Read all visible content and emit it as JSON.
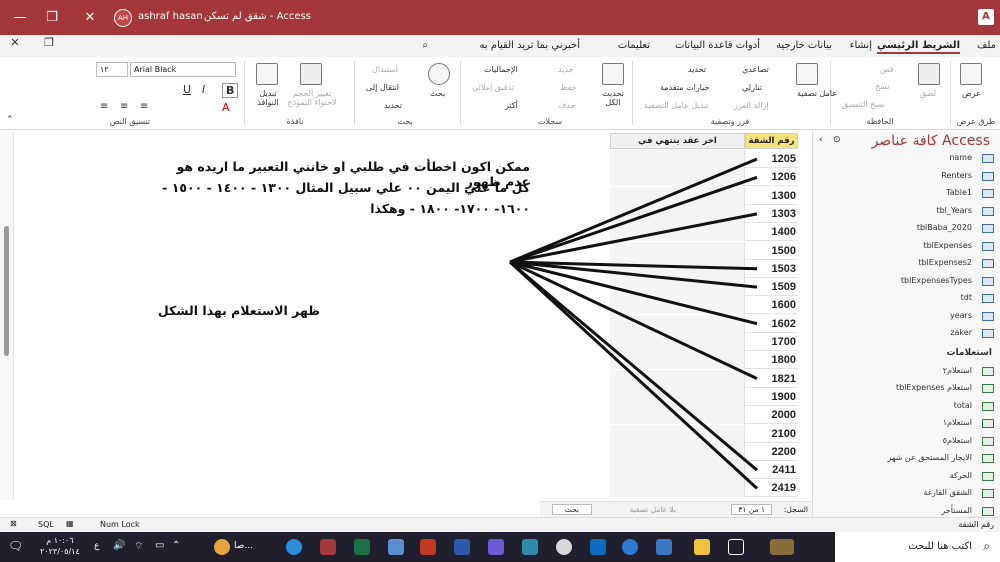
{
  "titlebar": {
    "title": "شقق لم تسكن  -  Access",
    "user_name": "ashraf hasan",
    "user_initials": "AH",
    "minimize": "—",
    "restore": "❐",
    "close": "✕"
  },
  "menu": {
    "items": [
      "ملف",
      "الشريط الرئيسي",
      "إنشاء",
      "بيانات خارجية",
      "أدوات قاعدة البيانات",
      "تعليمات"
    ],
    "tell_me": "أخبرني بما تريد القيام به"
  },
  "ribbon": {
    "groups": {
      "views": "طرق عرض",
      "clipboard": "الحافظة",
      "sort_filter": "فرز وتصفية",
      "records": "سجلات",
      "find": "بحث",
      "window": "نافذة",
      "text_format": "تنسيق النص"
    },
    "view_btn": "عرض",
    "paste": "لصق",
    "cut": "قص",
    "copy": "نسخ",
    "format_painter": "نسخ التنسيق",
    "filter": "عامل تصفية",
    "ascending": "تصاعدي",
    "descending": "تنازلي",
    "remove_sort": "إزالة الفرز",
    "selection": "تحديد",
    "advanced": "خيارات متقدمة",
    "toggle_filter": "تبديل عامل التصفية",
    "refresh_all": "تحديث الكل",
    "new": "جديد",
    "save": "حفظ",
    "delete": "حذف",
    "totals": "الإجماليات",
    "spelling": "تدقيق إملائي",
    "more": "أكثر",
    "find_btn": "بحث",
    "replace": "استبدال",
    "goto": "انتقال إلى",
    "select": "تحديد",
    "size_to_fit": "تغيير الحجم لاحتواء النموذج",
    "switch_windows": "تبديل النوافذ",
    "font_name": "Arial Black",
    "font_size": "١٢"
  },
  "nav": {
    "title": "كافة عناصر Access",
    "tables": [
      "name",
      "Renters",
      "Table1",
      "tbl_Years",
      "tblBaba_2020",
      "tblExpenses",
      "tblExpenses2",
      "tblExpensesTypes",
      "tdt",
      "years",
      "zaker"
    ],
    "queries_header": "استعلامات",
    "queries": [
      "استعلام٢",
      "tblExpenses استعلام",
      "total",
      "استعلام١",
      "استعلام٥",
      "الايجار المستحق عن شهر",
      "الحركة",
      "الشقق الفارغة",
      "المستأجر"
    ]
  },
  "sheet": {
    "col_apartment": "رقم الشقة",
    "col_contract": "اخر عقد ينتهي في",
    "rows": [
      "1205",
      "1206",
      "1300",
      "1303",
      "1400",
      "1500",
      "1503",
      "1509",
      "1600",
      "1602",
      "1700",
      "1800",
      "1821",
      "1900",
      "2000",
      "2100",
      "2200",
      "2411",
      "2419"
    ],
    "record_label": "السجل:",
    "record_pos": "١ من ٣١",
    "no_filter": "بلا عامل تصفية",
    "search": "بحث"
  },
  "notes": {
    "line1": "ممكن اكون اخطأت في طلبي او خانني التعبير  ما اريده هو عدم ظهور",
    "line2": "كل ما علي اليمن ٠٠ علي سبيل المثال ١٣٠٠ - ١٤٠٠ - ١٥٠٠ -",
    "line3": "١٦٠٠- ١٧٠٠- ١٨٠٠ - وهكذا",
    "line4": "ظهر الاستعلام بهذا الشكل"
  },
  "status": {
    "left": "رقم الشقة",
    "num_lock": "Num Lock",
    "sql": "SQL"
  },
  "taskbar": {
    "search": "اكتب هنا للبحث",
    "time": "١٠:٠٦ م",
    "date": "٢٠٢٣/٠٥/١٤",
    "lang": "ع",
    "weather": "صا..."
  }
}
